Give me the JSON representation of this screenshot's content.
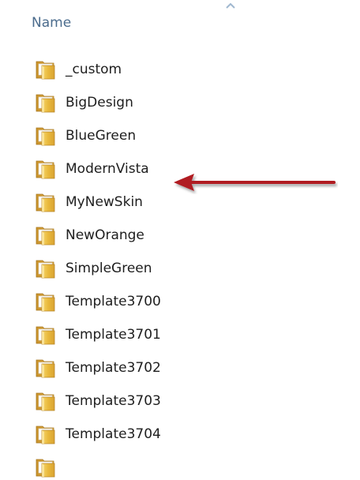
{
  "header": {
    "column_name": "Name"
  },
  "files": [
    {
      "name": "_custom",
      "icon": "folder-icon"
    },
    {
      "name": "BigDesign",
      "icon": "folder-icon"
    },
    {
      "name": "BlueGreen",
      "icon": "folder-icon"
    },
    {
      "name": "ModernVista",
      "icon": "folder-icon"
    },
    {
      "name": "MyNewSkin",
      "icon": "folder-icon"
    },
    {
      "name": "NewOrange",
      "icon": "folder-icon"
    },
    {
      "name": "SimpleGreen",
      "icon": "folder-icon"
    },
    {
      "name": "Template3700",
      "icon": "folder-icon"
    },
    {
      "name": "Template3701",
      "icon": "folder-icon"
    },
    {
      "name": "Template3702",
      "icon": "folder-icon"
    },
    {
      "name": "Template3703",
      "icon": "folder-icon"
    },
    {
      "name": "Template3704",
      "icon": "folder-icon"
    }
  ],
  "colors": {
    "header_text": "#4b6c8d",
    "file_text": "#1e1e1e",
    "folder": "#e9b93c",
    "annotation_arrow": "#b01c21"
  }
}
